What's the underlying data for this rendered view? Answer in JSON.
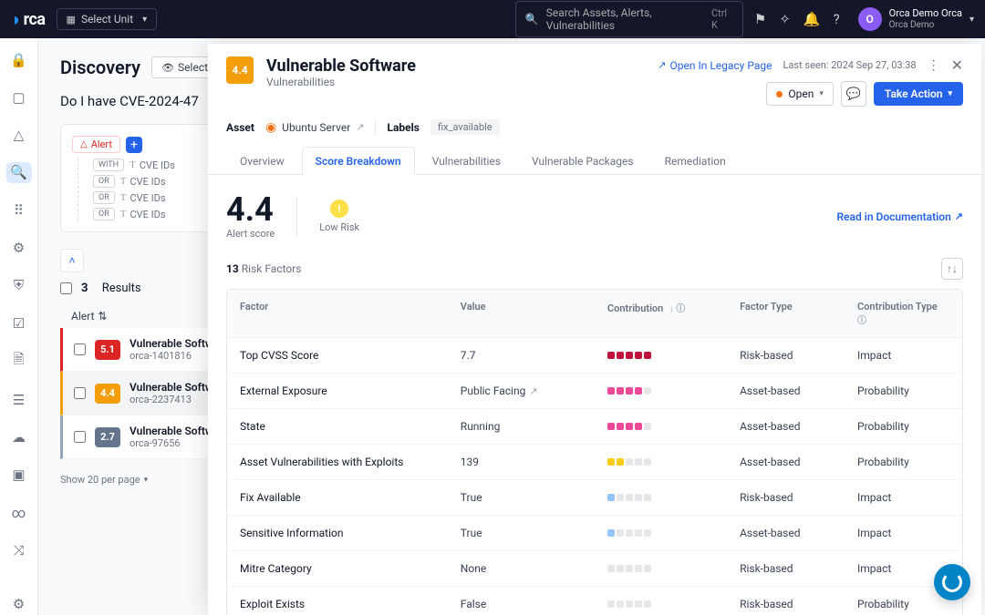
{
  "topbar": {
    "logo": "rca",
    "unit_select": "Select Unit",
    "search_placeholder": "Search Assets, Alerts, Vulnerabilities",
    "search_shortcut": "Ctrl K",
    "user_name": "Orca Demo Orca",
    "user_org": "Orca Demo",
    "avatar_letter": "O"
  },
  "discovery": {
    "title": "Discovery",
    "select_view": "Select View",
    "query": "Do I have CVE-2024-47",
    "alert_chip": "Alert",
    "conj_with": "WITH",
    "conj_or": "OR",
    "field_cve": "CVE IDs",
    "results_prefix": "3",
    "results_suffix": "Results",
    "alert_sort": "Alert",
    "items": [
      {
        "score": "5.1",
        "title": "Vulnerable Softwar",
        "id": "orca-1401816"
      },
      {
        "score": "4.4",
        "title": "Vulnerable Softwar",
        "id": "orca-2237413"
      },
      {
        "score": "2.7",
        "title": "Vulnerable Softwar",
        "id": "orca-97656"
      }
    ],
    "pagination": "Show 20 per page"
  },
  "detail": {
    "score_chip": "4.4",
    "title": "Vulnerable Software",
    "subtitle": "Vulnerabilities",
    "legacy": "Open In Legacy Page",
    "last_seen": "Last seen: 2024 Sep 27, 03:38",
    "status": "Open",
    "take_action": "Take Action",
    "asset_label": "Asset",
    "asset_name": "Ubuntu Server",
    "labels_label": "Labels",
    "label_chip": "fix_available",
    "tabs": [
      "Overview",
      "Score Breakdown",
      "Vulnerabilities",
      "Vulnerable Packages",
      "Remediation"
    ],
    "alert_score": "4.4",
    "alert_score_label": "Alert score",
    "risk_level": "Low Risk",
    "doc_link": "Read in Documentation",
    "rf_count": "13",
    "rf_label": "Risk Factors",
    "columns": {
      "factor": "Factor",
      "value": "Value",
      "contribution": "Contribution",
      "factor_type": "Factor Type",
      "contribution_type": "Contribution Type"
    },
    "rows": [
      {
        "factor": "Top CVSS Score",
        "value": "7.7",
        "contrib": 5,
        "color": "r",
        "ftype": "Risk-based",
        "ctype": "Impact"
      },
      {
        "factor": "External Exposure",
        "value": "Public Facing",
        "value_ext": true,
        "contrib": 4,
        "color": "p",
        "ftype": "Asset-based",
        "ctype": "Probability"
      },
      {
        "factor": "State",
        "value": "Running",
        "contrib": 4,
        "color": "p",
        "ftype": "Asset-based",
        "ctype": "Probability"
      },
      {
        "factor": "Asset Vulnerabilities with Exploits",
        "value": "139",
        "contrib": 2,
        "color": "y",
        "ftype": "Asset-based",
        "ctype": "Probability"
      },
      {
        "factor": "Fix Available",
        "value": "True",
        "contrib": 1,
        "color": "b",
        "ftype": "Risk-based",
        "ctype": "Impact"
      },
      {
        "factor": "Sensitive Information",
        "value": "True",
        "contrib": 1,
        "color": "b",
        "ftype": "Asset-based",
        "ctype": "Impact"
      },
      {
        "factor": "Mitre Category",
        "value": "None",
        "contrib": 0,
        "color": "",
        "ftype": "Risk-based",
        "ctype": "Impact"
      },
      {
        "factor": "Exploit Exists",
        "value": "False",
        "contrib": 0,
        "color": "",
        "ftype": "Risk-based",
        "ctype": "Probability"
      }
    ]
  }
}
